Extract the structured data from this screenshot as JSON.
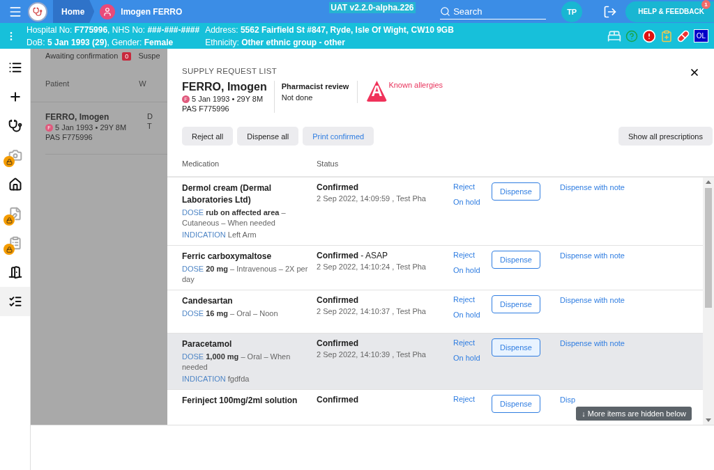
{
  "header": {
    "home": "Home",
    "patient": "Imogen FERRO",
    "version": "UAT v2.2.0-alpha.226",
    "search": {
      "placeholder": "Search"
    },
    "avatar": "TP",
    "help": "HELP & FEEDBACK",
    "help_badge": "1"
  },
  "patient_bar": {
    "line1_left": "Hospital No: **F775996**, NHS No: **###-###-####**",
    "line2_left": "DoB: **5 Jan 1993 (29)**, Gender: **Female**",
    "line1_right": "Address: **5562 Fairfield St #847, Ryde, Isle Of Wight, CW10 9GB**",
    "line2_right": "Ethnicity: **Other ethnic group - other**",
    "badge": "OL"
  },
  "sidebar": {
    "items": [
      {
        "kind": "list",
        "locked": false,
        "selected": false
      },
      {
        "kind": "plus",
        "locked": false,
        "selected": false
      },
      {
        "kind": "stethoscope",
        "locked": false,
        "selected": false
      },
      {
        "kind": "camera",
        "locked": true,
        "selected": false
      },
      {
        "kind": "home",
        "locked": false,
        "selected": false
      },
      {
        "kind": "edit",
        "locked": true,
        "selected": false
      },
      {
        "kind": "clipboard",
        "locked": true,
        "selected": false
      },
      {
        "kind": "leave",
        "locked": false,
        "selected": false
      },
      {
        "kind": "checklist",
        "locked": false,
        "selected": true
      }
    ]
  },
  "background": {
    "tabs": [
      {
        "label": "Awaiting confirmation",
        "count": "0"
      },
      {
        "label": "Suspe"
      }
    ],
    "columns": [
      "Patient",
      "W"
    ],
    "row": {
      "name": "FERRO, Imogen",
      "sex": "F",
      "dob": "5 Jan 1993 • 29Y 8M",
      "pas": "PAS F775996",
      "column_2_line1": "D",
      "column_2_line2": "T"
    }
  },
  "modal": {
    "title": "SUPPLY REQUEST LIST",
    "patient": {
      "name": "FERRO, Imogen",
      "sex": "F",
      "dob": "5 Jan 1993 • 29Y 8M",
      "pas": "PAS F775996"
    },
    "review": {
      "label": "Pharmacist review",
      "value": "Not done"
    },
    "allergy": {
      "symbol": "A",
      "label": "Known allergies"
    },
    "buttons": [
      "Reject all",
      "Dispense all",
      "Print confirmed"
    ],
    "show_all": "Show all prescriptions",
    "columns": [
      "Medication",
      "Status"
    ],
    "rows": [
      {
        "name": "Dermol cream (Dermal Laboratories Ltd)",
        "details": [
          {
            "label": "DOSE",
            "text": "**rub on affected area** – Cutaneous – When needed"
          },
          {
            "label": "INDICATION",
            "text": "Left Arm"
          }
        ],
        "status": "Confirmed",
        "date": "2 Sep 2022, 14:09:59 , Test Pha",
        "reject": "Reject",
        "hold": "On hold",
        "dispense": "Dispense",
        "note": "Dispense with note",
        "highlighted": false
      },
      {
        "name": "Ferric carboxymaltose",
        "details": [
          {
            "label": "DOSE",
            "text": "**20 mg** – Intravenous – 2X per day"
          }
        ],
        "status": "Confirmed",
        "status_note": " - ASAP",
        "date": "2 Sep 2022, 14:10:24 , Test Pha",
        "reject": "Reject",
        "hold": "On hold",
        "dispense": "Dispense",
        "note": "Dispense with note",
        "highlighted": false
      },
      {
        "name": "Candesartan",
        "details": [
          {
            "label": "DOSE",
            "text": "**16 mg** – Oral – Noon"
          }
        ],
        "status": "Confirmed",
        "date": "2 Sep 2022, 14:10:37 , Test Pha",
        "reject": "Reject",
        "hold": "On hold",
        "dispense": "Dispense",
        "note": "Dispense with note",
        "highlighted": false
      },
      {
        "name": "Paracetamol",
        "details": [
          {
            "label": "DOSE",
            "text": "**1,000 mg** – Oral – When needed"
          },
          {
            "label": "INDICATION",
            "text": "fgdfda"
          }
        ],
        "status": "Confirmed",
        "date": "2 Sep 2022, 14:10:39 , Test Pha",
        "reject": "Reject",
        "hold": "On hold",
        "dispense": "Dispense",
        "note": "Dispense with note",
        "highlighted": true
      },
      {
        "name": "Ferinject 100mg/2ml solution",
        "details": [],
        "status": "Confirmed",
        "reject": "Reject",
        "dispense": "Dispense",
        "note": "Disp",
        "highlighted": false
      }
    ],
    "hidden_notice": "↓ More items are hidden below"
  }
}
